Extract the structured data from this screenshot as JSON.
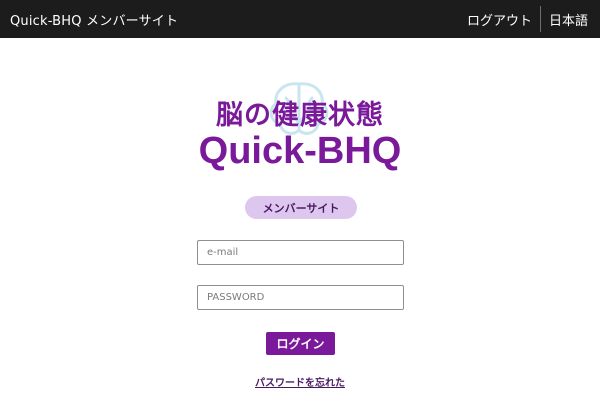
{
  "header": {
    "site_title": "Quick-BHQ メンバーサイト",
    "logout_label": "ログアウト",
    "language_label": "日本語"
  },
  "hero": {
    "heading_jp": "脳の健康状態",
    "brand": "Quick-BHQ",
    "badge": "メンバーサイト"
  },
  "form": {
    "email_placeholder": "e-mail",
    "email_value": "",
    "password_placeholder": "PASSWORD",
    "password_value": "",
    "login_label": "ログイン",
    "forgot_label": "パスワードを忘れた"
  },
  "colors": {
    "header_bg": "#1c1c1c",
    "brand_purple": "#7a1a9a",
    "badge_bg": "#ddc7ee"
  },
  "icons": {
    "logo": "brain-watermark-icon"
  }
}
